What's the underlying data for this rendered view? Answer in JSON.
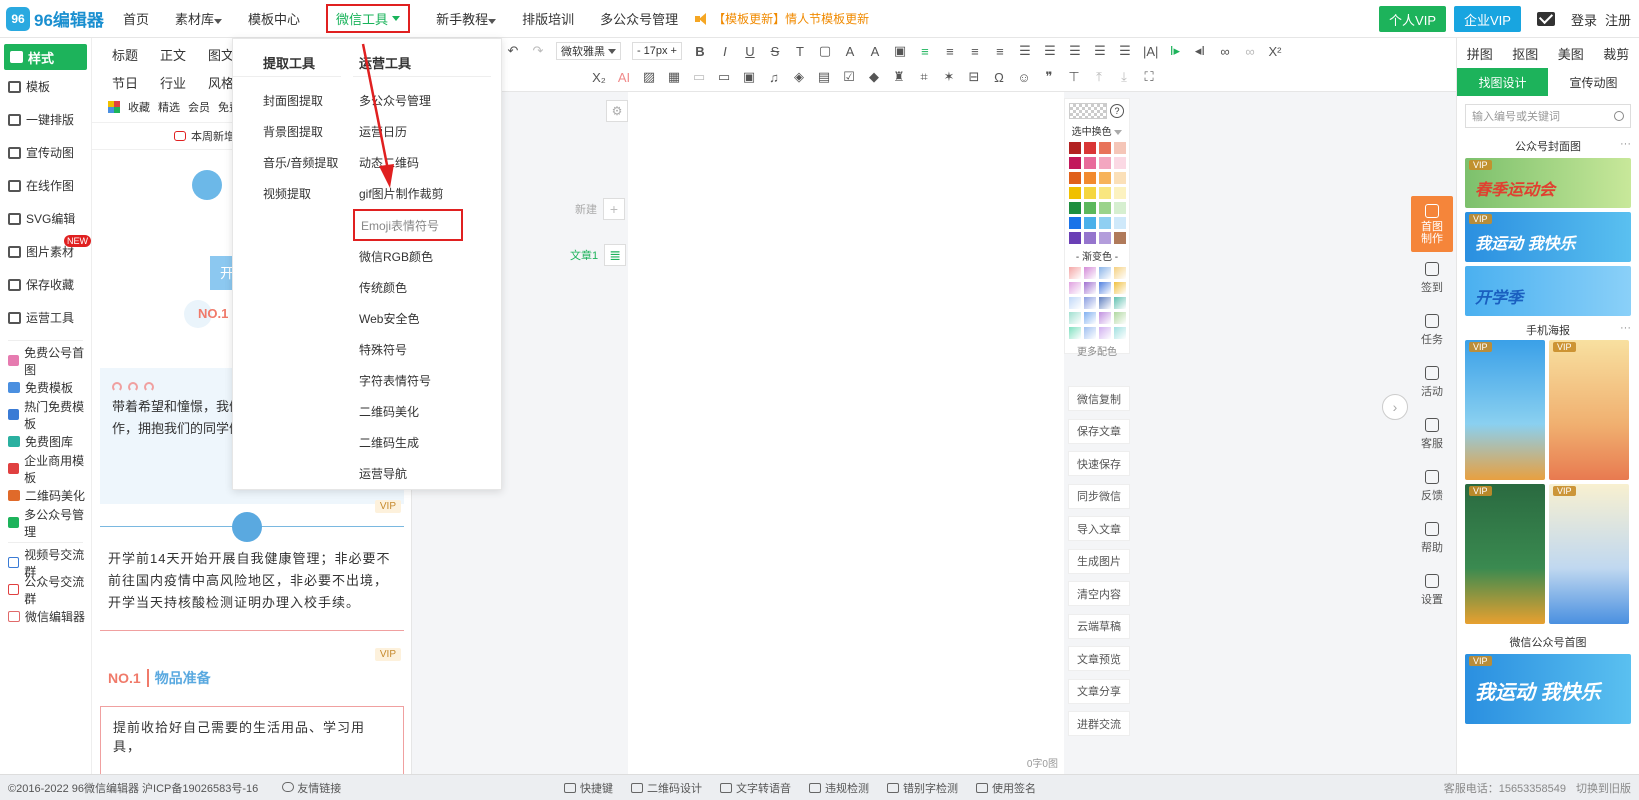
{
  "brand": {
    "logo_mark": "96",
    "name": "96编辑器"
  },
  "nav": {
    "items": [
      {
        "label": "首页",
        "caret": false
      },
      {
        "label": "素材库",
        "caret": true
      },
      {
        "label": "模板中心",
        "caret": false
      },
      {
        "label": "微信工具",
        "caret": true,
        "active": true
      },
      {
        "label": "新手教程",
        "caret": true
      },
      {
        "label": "排版培训",
        "caret": false
      },
      {
        "label": "多公众号管理",
        "caret": false
      }
    ],
    "announcement": "【模板更新】情人节模板更新",
    "vip_button": "个人VIP",
    "enterprise_vip_button": "企业VIP",
    "login": "登录",
    "register": "注册"
  },
  "sidebar": {
    "items": [
      {
        "label": "样式",
        "active": true
      },
      {
        "label": "模板"
      },
      {
        "label": "一键排版"
      },
      {
        "label": "宣传动图"
      },
      {
        "label": "在线作图"
      },
      {
        "label": "SVG编辑"
      },
      {
        "label": "图片素材",
        "badge": "NEW"
      },
      {
        "label": "保存收藏"
      },
      {
        "label": "运营工具"
      }
    ],
    "links": [
      {
        "label": "免费公号首图",
        "color": "#e67bb0"
      },
      {
        "label": "免费模板",
        "color": "#4a8fe0"
      },
      {
        "label": "热门免费模板",
        "color": "#3a7bd5"
      },
      {
        "label": "免费图库",
        "color": "#2ab0a0"
      },
      {
        "label": "企业商用模板",
        "color": "#e04040"
      },
      {
        "label": "二维码美化",
        "color": "#e06a2a"
      },
      {
        "label": "多公众号管理",
        "color": "#1db35b"
      }
    ],
    "groups": [
      {
        "label": "视频号交流群",
        "color": "#3a7bd5"
      },
      {
        "label": "公众号交流群",
        "color": "#e04040"
      },
      {
        "label": "微信编辑器",
        "color": "#e06a6a"
      }
    ]
  },
  "style_panel": {
    "categories_row1": [
      "标题",
      "正文",
      "图文"
    ],
    "categories_row2": [
      "节日",
      "行业",
      "风格"
    ],
    "filters": [
      "收藏",
      "精选",
      "会员",
      "免费"
    ],
    "weekly": "本周新增",
    "kaixue_char": "开",
    "no1": "NO.1",
    "card_text": "带着希望和憧憬，我们满怀热情积极的投入工作，拥抱我们的同学们；加油成长。",
    "vip": "VIP",
    "para": "开学前14天开始开展自我健康管理；非必要不前往国内疫情中高风险地区，非必要不出境，开学当天持核酸检测证明办理入校手续。",
    "heading_num": "NO.1",
    "heading_title": "物品准备",
    "outline_text": "提前收拾好自己需要的生活用品、学习用具，"
  },
  "dropdown": {
    "left_title": "提取工具",
    "left_items": [
      "封面图提取",
      "背景图提取",
      "音乐/音频提取",
      "视频提取"
    ],
    "right_title": "运营工具",
    "right_items": [
      "多公众号管理",
      "运营日历",
      "动态二维码",
      "gif图片制作裁剪",
      "Emoji表情符号",
      "微信RGB颜色",
      "传统颜色",
      "Web安全色",
      "特殊符号",
      "字符表情符号",
      "二维码美化",
      "二维码生成",
      "运营导航"
    ],
    "highlighted": "Emoji表情符号"
  },
  "toolbar": {
    "font_family": "微软雅黑",
    "font_size": "17px",
    "minus": "-",
    "plus": "+",
    "ai": "AI"
  },
  "canvas": {
    "new_label": "新建",
    "doc_label": "文章1",
    "word_count": "0字0图"
  },
  "palette": {
    "selected_label": "选中换色",
    "gradient_label": "- 渐变色 -",
    "more_label": "更多配色",
    "solid": [
      "#b22222",
      "#d93636",
      "#e8735a",
      "#f5c6b8",
      "#c2185b",
      "#e86a9a",
      "#f3a6c0",
      "#fbd9e4",
      "#e0601a",
      "#f28a2e",
      "#f7b35a",
      "#fbe0b8",
      "#f0c000",
      "#f5d640",
      "#f9e680",
      "#fcf2c0",
      "#1e8e3e",
      "#5cb85c",
      "#9ad38a",
      "#d6efd0",
      "#1a73e8",
      "#4ab0ea",
      "#8fcff2",
      "#cfe9fa",
      "#6a3fb5",
      "#9575cd",
      "#b39ddb",
      "#b07a5a"
    ],
    "gradient": [
      "#f4a6a6",
      "#d48ad8",
      "#8ab4e8",
      "#f5d080",
      "#e0a0e0",
      "#a070d0",
      "#5080e0",
      "#f0c040",
      "#c0d8f8",
      "#8a9ee0",
      "#6080c0",
      "#60c0b0",
      "#a0e0d0",
      "#80b0f0",
      "#c090e0",
      "#b0d8a0",
      "#80e0c0",
      "#a0c0f0",
      "#d0b0f0",
      "#a0e0e0"
    ]
  },
  "actions": [
    "微信复制",
    "保存文章",
    "快速保存",
    "同步微信",
    "导入文章",
    "生成图片",
    "清空内容",
    "云端草稿",
    "文章预览",
    "文章分享",
    "进群交流"
  ],
  "strip": [
    {
      "label": "首图制作",
      "highlight": true
    },
    {
      "label": "签到"
    },
    {
      "label": "任务"
    },
    {
      "label": "活动"
    },
    {
      "label": "客服"
    },
    {
      "label": "反馈"
    },
    {
      "label": "帮助"
    },
    {
      "label": "设置"
    }
  ],
  "right_panel": {
    "tabs": [
      "拼图",
      "抠图",
      "美图",
      "裁剪"
    ],
    "sub_tabs": [
      "找图设计",
      "宣传动图"
    ],
    "search_placeholder": "输入编号或关键词",
    "section1": "公众号封面图",
    "section2": "手机海报",
    "section3": "微信公众号首图",
    "vip": "VIP",
    "thumb1_text": "春季运动会",
    "thumb2_text": "我运动 我快乐",
    "thumb3_text": "开学季",
    "thumb4_text": "我运动 我快乐"
  },
  "footer": {
    "copyright": "©2016-2022 96微信编辑器 沪ICP备19026583号-16",
    "friend_links": "友情链接",
    "tools": [
      "快捷键",
      "二维码设计",
      "文字转语音",
      "违规检测",
      "错别字检测",
      "使用签名"
    ],
    "hotline": "客服电话：15653358549",
    "old_version": "切换到旧版"
  }
}
